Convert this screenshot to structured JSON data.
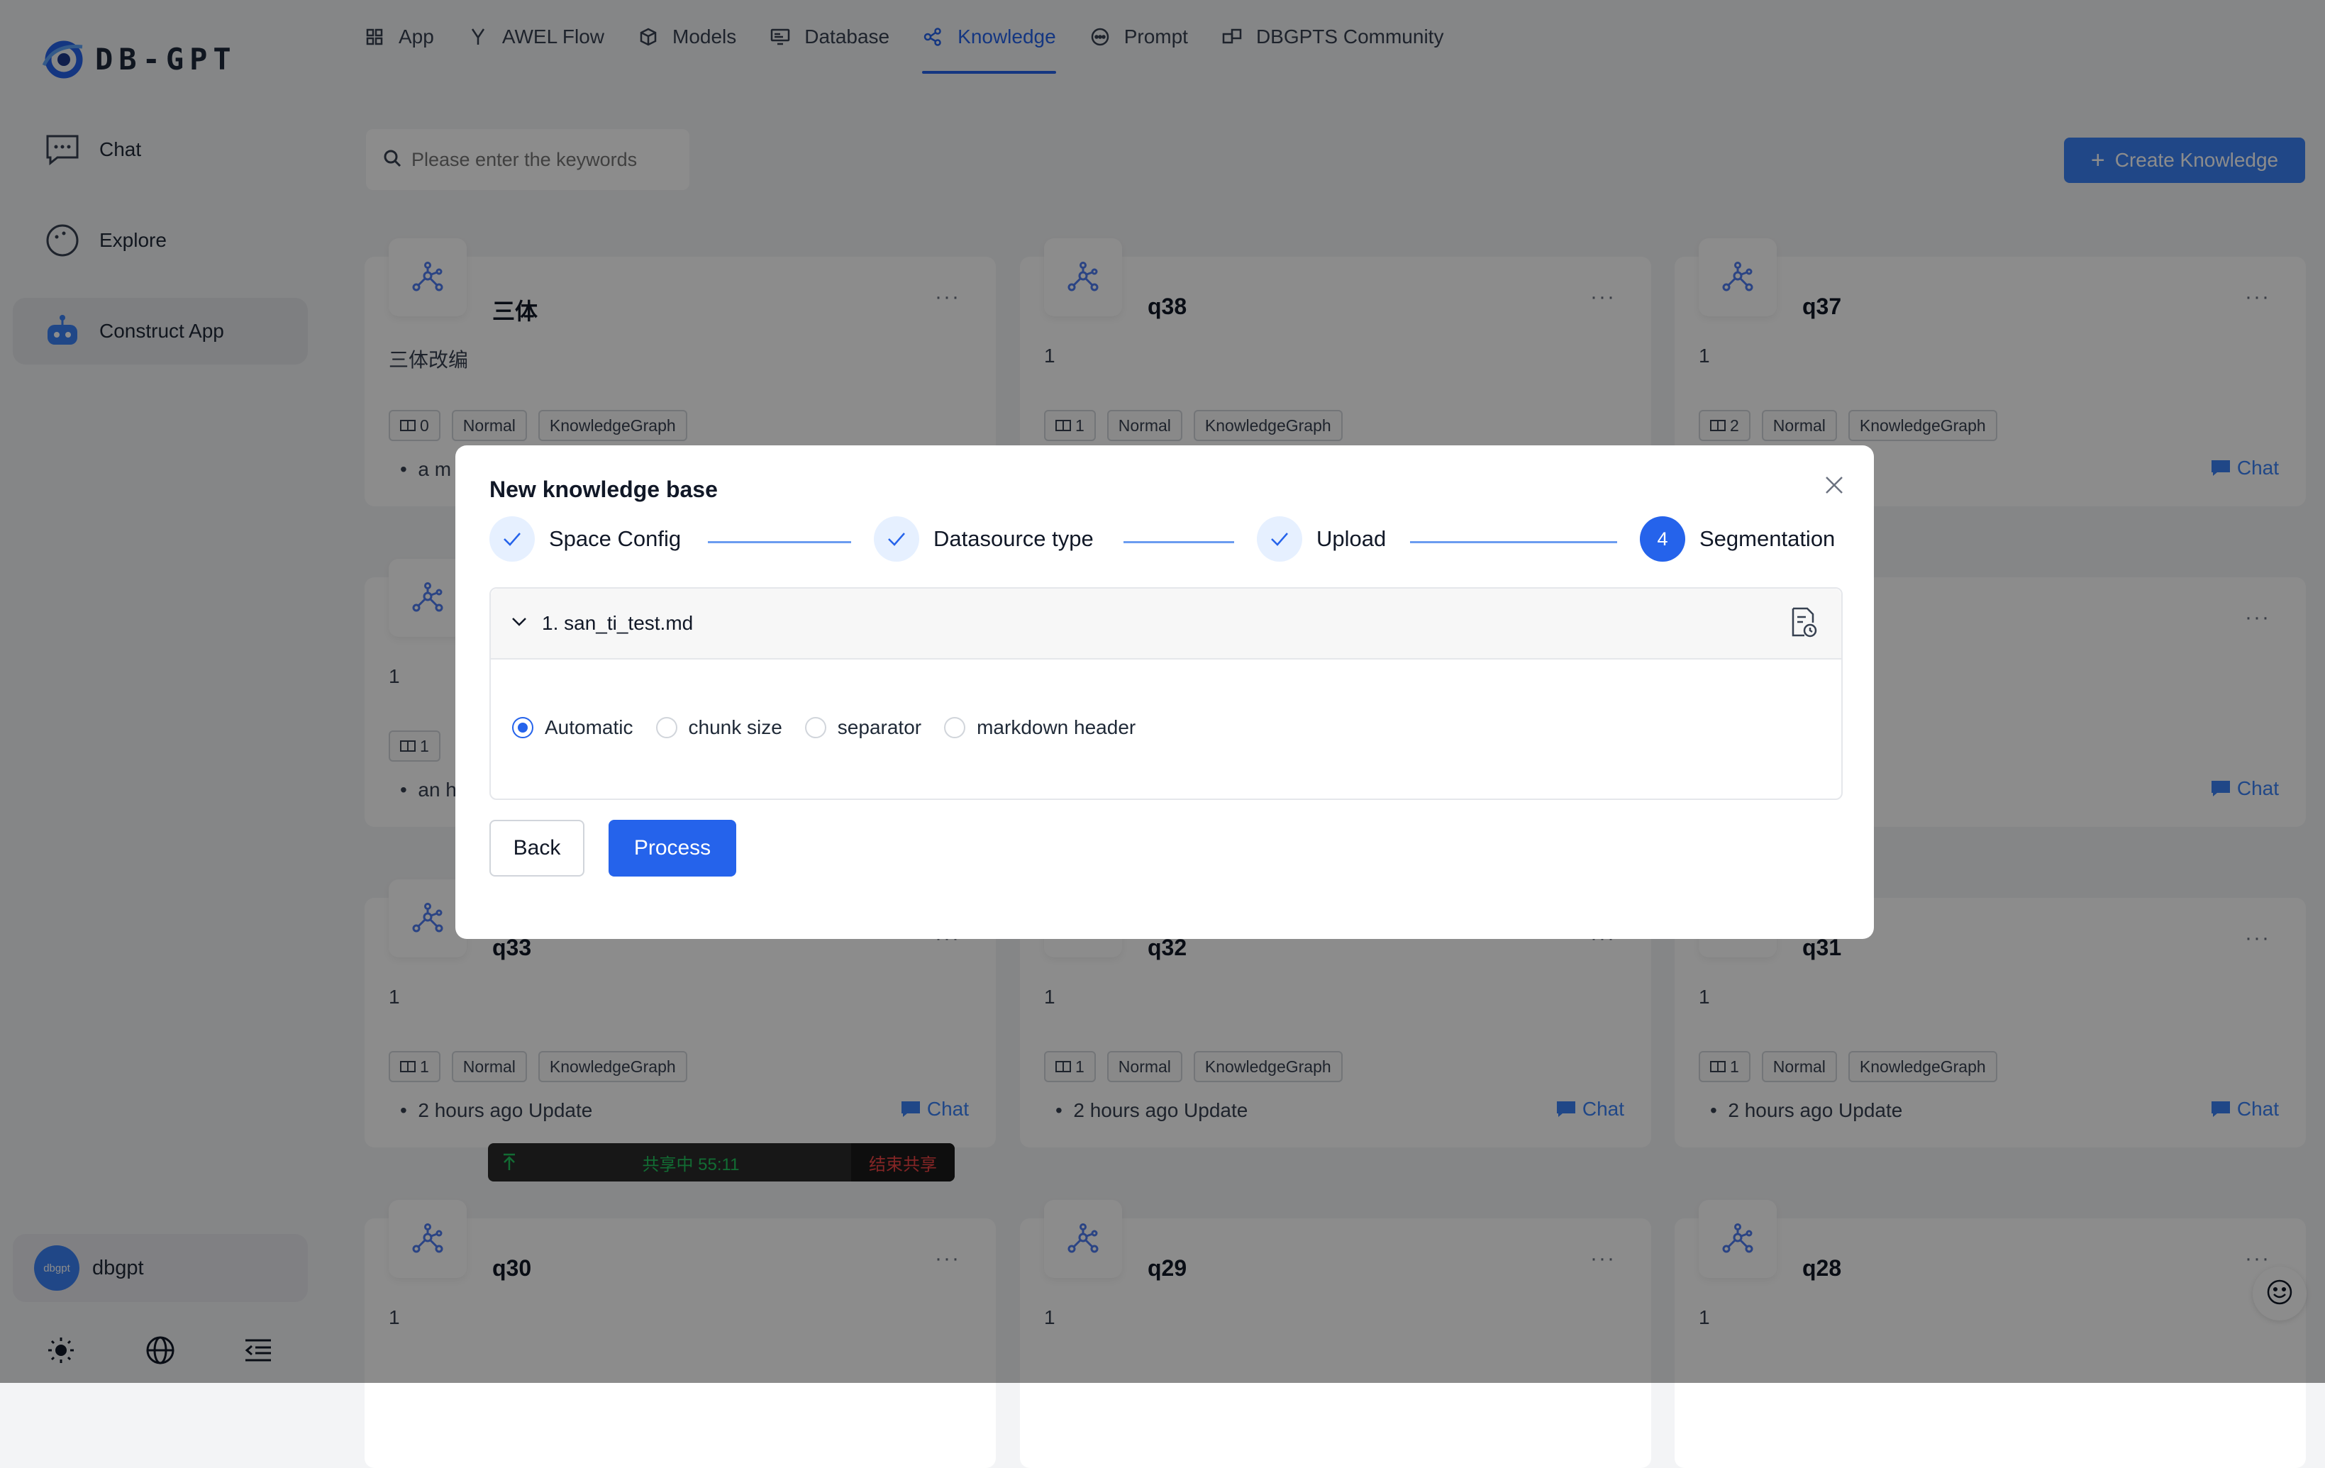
{
  "app": {
    "logo_text": "DB-GPT"
  },
  "sidebar": {
    "items": [
      {
        "label": "Chat",
        "icon": "chat-bubble-icon"
      },
      {
        "label": "Explore",
        "icon": "compass-icon"
      },
      {
        "label": "Construct App",
        "icon": "robot-icon"
      }
    ],
    "user": {
      "avatar_text": "dbgpt",
      "name": "dbgpt"
    }
  },
  "topnav": {
    "tabs": [
      {
        "label": "App",
        "icon": "grid-icon"
      },
      {
        "label": "AWEL Flow",
        "icon": "flow-icon"
      },
      {
        "label": "Models",
        "icon": "cube-icon"
      },
      {
        "label": "Database",
        "icon": "database-icon"
      },
      {
        "label": "Knowledge",
        "icon": "knowledge-icon"
      },
      {
        "label": "Prompt",
        "icon": "prompt-icon"
      },
      {
        "label": "DBGPTS Community",
        "icon": "community-icon"
      }
    ],
    "active": "Knowledge"
  },
  "search": {
    "placeholder": "Please enter the keywords"
  },
  "create_button": {
    "label": "Create Knowledge"
  },
  "cards": [
    {
      "title": "三体",
      "desc": "三体改编",
      "docs": "0",
      "tag1": "Normal",
      "tag2": "KnowledgeGraph",
      "update": "a m",
      "chat": ""
    },
    {
      "title": "q38",
      "desc": "1",
      "docs": "1",
      "tag1": "Normal",
      "tag2": "KnowledgeGraph",
      "update": "",
      "chat": ""
    },
    {
      "title": "q37",
      "desc": "1",
      "docs": "2",
      "tag1": "Normal",
      "tag2": "KnowledgeGraph",
      "update": "date",
      "chat": "Chat"
    },
    {
      "title": "",
      "desc": "1",
      "docs": "1",
      "tag1": "",
      "tag2": "",
      "update": "an h",
      "chat": ""
    },
    {
      "title": "",
      "desc": "",
      "docs": "",
      "tag1": "",
      "tag2": "",
      "update": "",
      "chat": ""
    },
    {
      "title": "",
      "desc": "",
      "docs": "",
      "tag1": "",
      "tag2": "nowledgeGraph",
      "update": "date",
      "chat": "Chat"
    },
    {
      "title": "q33",
      "desc": "1",
      "docs": "1",
      "tag1": "Normal",
      "tag2": "KnowledgeGraph",
      "update": "2 hours ago Update",
      "chat": "Chat"
    },
    {
      "title": "q32",
      "desc": "1",
      "docs": "1",
      "tag1": "Normal",
      "tag2": "KnowledgeGraph",
      "update": "2 hours ago Update",
      "chat": "Chat"
    },
    {
      "title": "q31",
      "desc": "1",
      "docs": "1",
      "tag1": "Normal",
      "tag2": "KnowledgeGraph",
      "update": "2 hours ago Update",
      "chat": "Chat"
    },
    {
      "title": "q30",
      "desc": "1",
      "docs": "",
      "tag1": "",
      "tag2": "",
      "update": "",
      "chat": ""
    },
    {
      "title": "q29",
      "desc": "1",
      "docs": "",
      "tag1": "",
      "tag2": "",
      "update": "",
      "chat": ""
    },
    {
      "title": "q28",
      "desc": "1",
      "docs": "",
      "tag1": "",
      "tag2": "",
      "update": "",
      "chat": ""
    }
  ],
  "modal": {
    "title": "New knowledge base",
    "steps": [
      {
        "label": "Space Config",
        "status": "done"
      },
      {
        "label": "Datasource type",
        "status": "done"
      },
      {
        "label": "Upload",
        "status": "done"
      },
      {
        "label": "Segmentation",
        "status": "current",
        "number": "4"
      }
    ],
    "file": {
      "name": "1. san_ti_test.md"
    },
    "options": [
      {
        "label": "Automatic",
        "selected": true
      },
      {
        "label": "chunk size",
        "selected": false
      },
      {
        "label": "separator",
        "selected": false
      },
      {
        "label": "markdown header",
        "selected": false
      }
    ],
    "back_label": "Back",
    "process_label": "Process"
  },
  "share_bar": {
    "status": "共享中 55:11",
    "stop_label": "结束共享"
  },
  "colors": {
    "accent": "#2563eb",
    "chat_link": "#3b82f6",
    "share_green": "#22c55e",
    "share_red": "#ef4444"
  }
}
